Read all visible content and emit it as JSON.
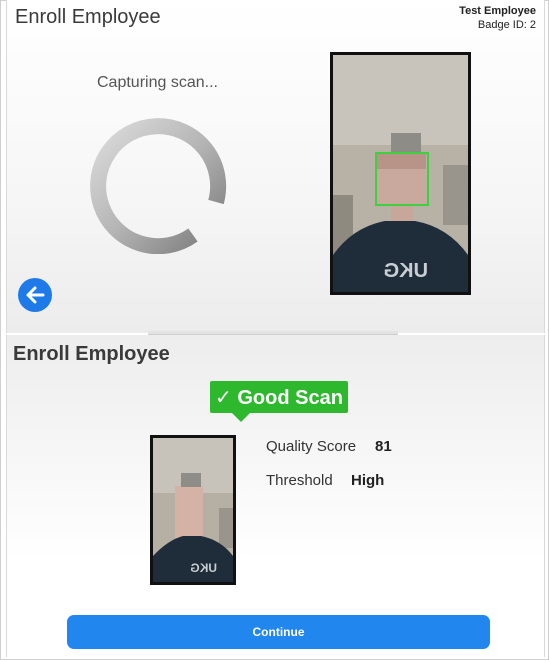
{
  "capture_panel": {
    "title": "Enroll Employee",
    "employee_name": "Test Employee",
    "badge": "Badge ID: 2",
    "status": "Capturing scan...",
    "shirt_logo": "UKG"
  },
  "result_panel": {
    "title": "Enroll Employee",
    "result_label": "✓ Good Scan",
    "quality_label": "Quality Score",
    "quality_value": "81",
    "threshold_label": "Threshold",
    "threshold_value": "High",
    "continue_label": "Continue"
  },
  "icons": {
    "back": "arrow-left-icon",
    "spinner": "loading-spinner",
    "face_box": "face-detection-box"
  },
  "colors": {
    "primary_blue": "#2187ee",
    "success_green": "#2eb82e",
    "face_box_green": "#3fcf3f"
  }
}
